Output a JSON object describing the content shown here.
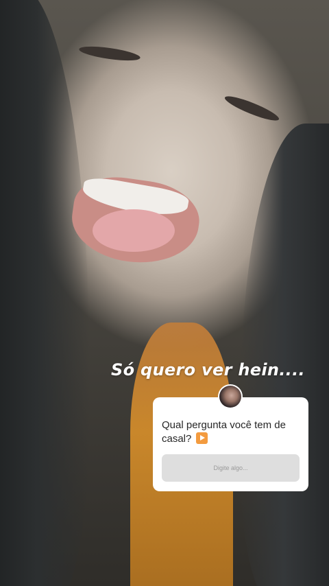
{
  "story": {
    "caption": "Só quero ver hein....",
    "question_sticker": {
      "question": "Qual pergunta você tem de casal?",
      "emoji": "arrow-forward-emoji",
      "input_placeholder": "Digite algo..."
    }
  },
  "colors": {
    "sticker_background": "#ffffff",
    "input_background": "#dedede",
    "emoji_orange": "#f39b3f",
    "caption_color": "#ffffff"
  }
}
